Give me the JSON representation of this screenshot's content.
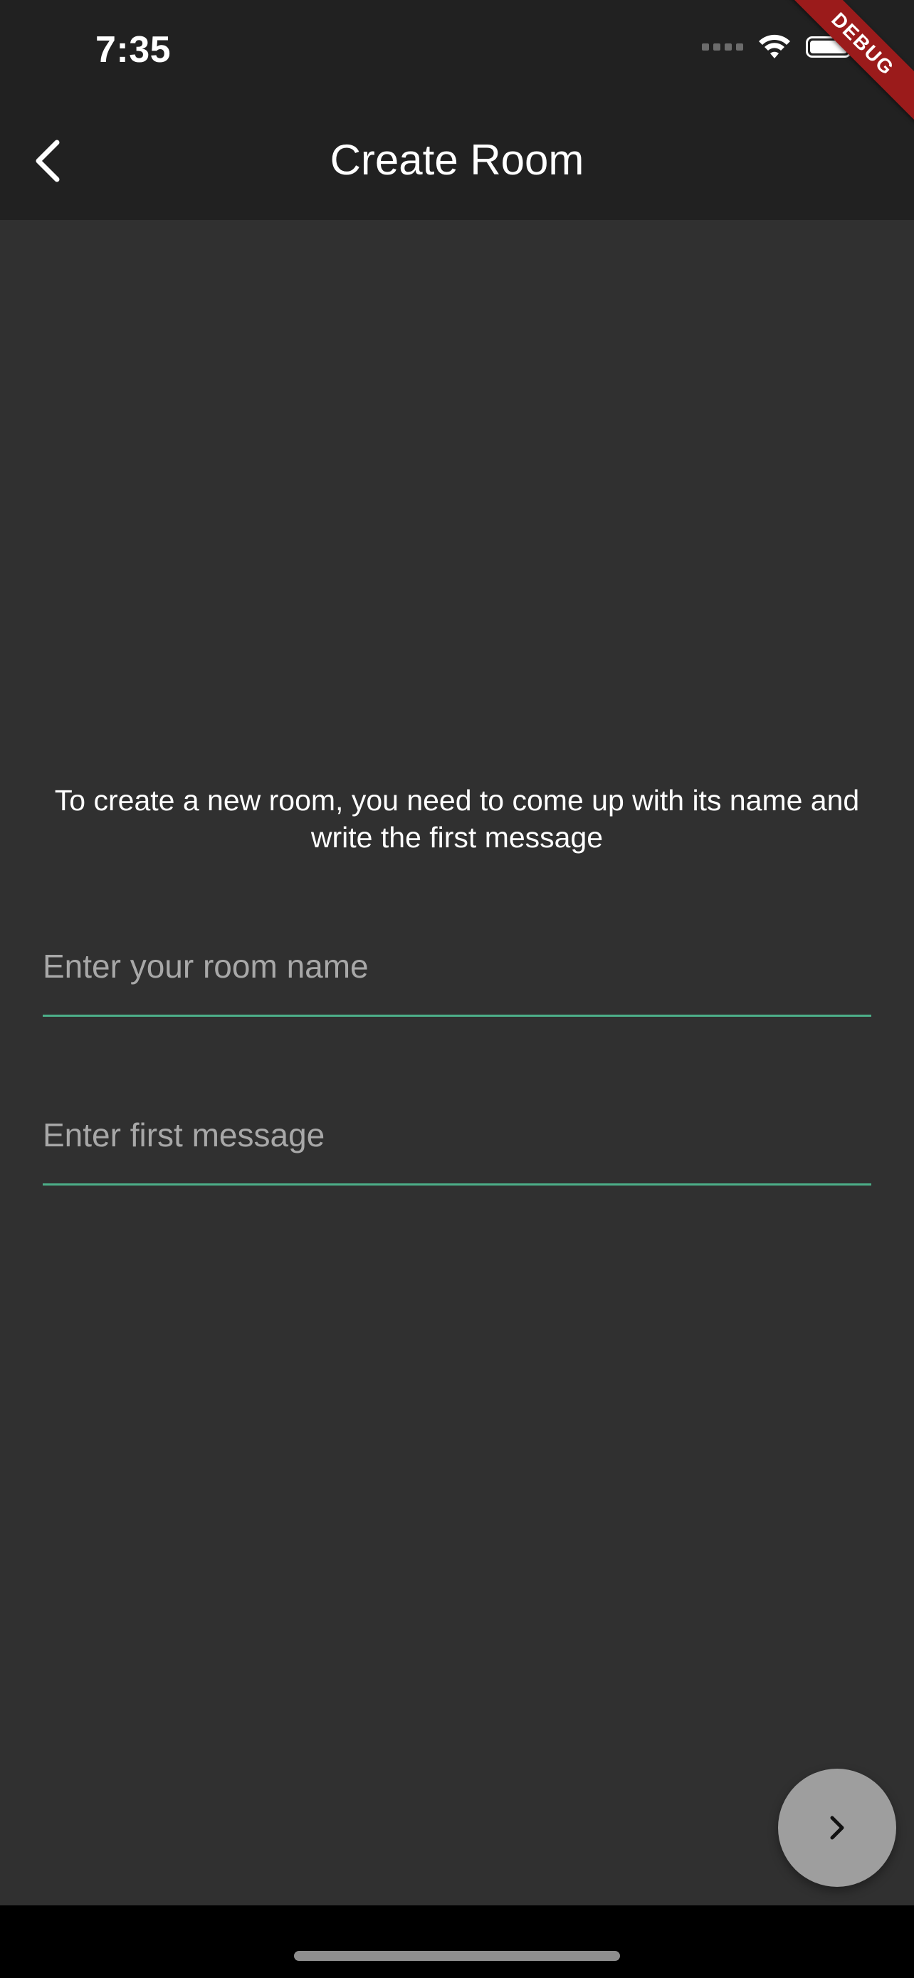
{
  "status_bar": {
    "time": "7:35"
  },
  "debug_banner": {
    "label": "DEBUG"
  },
  "app_bar": {
    "title": "Create Room",
    "back_icon": "chevron-left-icon"
  },
  "content": {
    "intro_text": "To create a new room, you need to come up with its name and write the first message",
    "room_name_field": {
      "value": "",
      "placeholder": "Enter your room name"
    },
    "first_message_field": {
      "value": "",
      "placeholder": "Enter first message"
    }
  },
  "fab": {
    "icon": "chevron-right-icon"
  },
  "colors": {
    "background": "#303030",
    "app_bar": "#212121",
    "accent_underline": "#4caf89",
    "fab": "#9e9e9e",
    "debug_ribbon": "#9b1b1b"
  }
}
